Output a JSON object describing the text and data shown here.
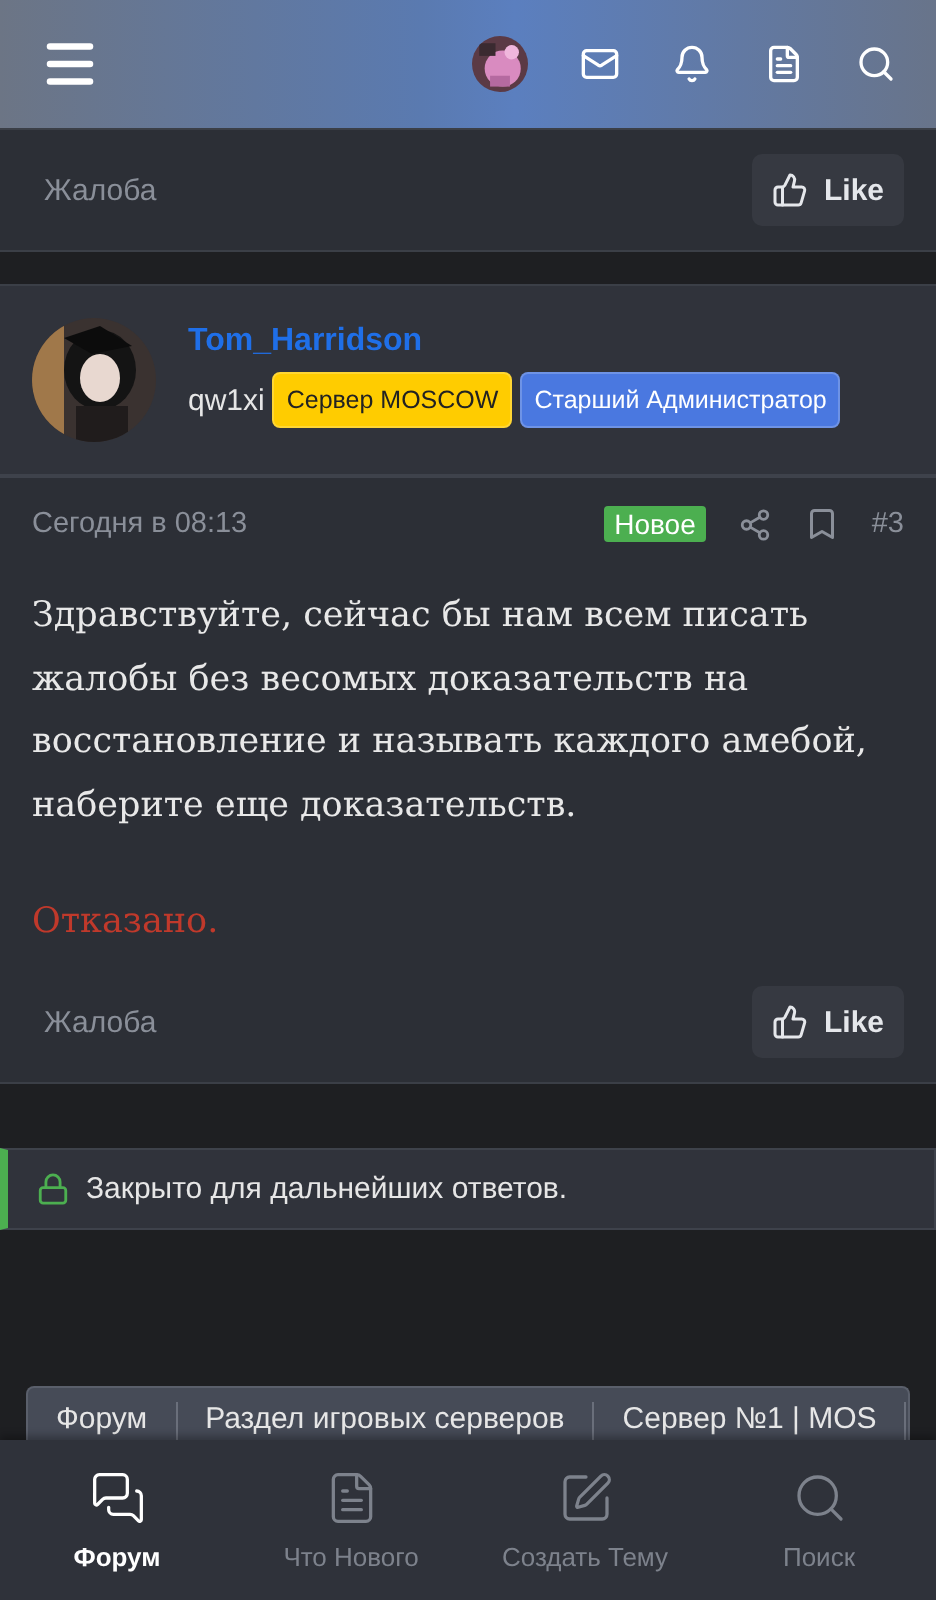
{
  "previous_post": {
    "report": "Жалоба",
    "like": "Like"
  },
  "post": {
    "author": "Tom_Harridson",
    "subtitle": "qw1xi",
    "badges": [
      {
        "label": "Сервер MOSCOW",
        "color": "#ffcc00"
      },
      {
        "label": "Старший Администратор",
        "color": "#4a78e0"
      }
    ],
    "date": "Сегодня в 08:13",
    "new_label": "Новое",
    "number": "#3",
    "body": "Здравствуйте, сейчас бы нам всем писать жалобы без весомых доказательств на восстановление и называть каждого амебой, наберите еще доказательств.",
    "verdict": "Отказано.",
    "report": "Жалоба",
    "like": "Like"
  },
  "closed_notice": "Закрыто для дальнейших ответов.",
  "breadcrumbs": [
    "Форум",
    "Раздел игровых серверов",
    "Сервер №1 | MOS"
  ],
  "bottom_nav": [
    {
      "label": "Форум",
      "selected": true
    },
    {
      "label": "Что Нового",
      "selected": false
    },
    {
      "label": "Создать Тему",
      "selected": false
    },
    {
      "label": "Поиск",
      "selected": false
    }
  ]
}
